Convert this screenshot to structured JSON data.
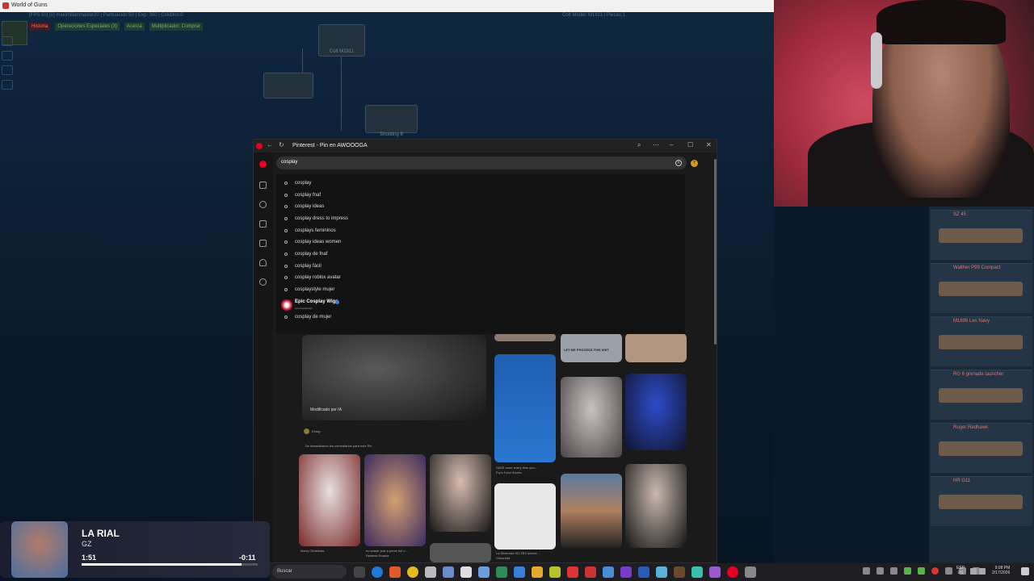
{
  "game": {
    "window_title": "World of Guns",
    "stats_left": "[FPS 50] [#] maximilianmaster20 | Puntuación:50 | Exp: 360 | Créditos:0",
    "stats_right": "Colt Model: M1911 | Piezas:1",
    "tabs": [
      "Historia",
      "Operaciones Especiales (3)",
      "Acerca",
      "Multiplicador: Comprar"
    ],
    "nodes": [
      "Colt M1911",
      "Shooting 6"
    ]
  },
  "gun_panel": {
    "items": [
      "SZ 45",
      "Walther P99 Compact",
      "M1896 Les Navy",
      "RG 6 grenade launcher",
      "Ruger Redhawk",
      "HR G11"
    ]
  },
  "music": {
    "title": "LA RIAL",
    "artist": "GZ",
    "current_time": "1:51",
    "remaining_time": "-0:11",
    "progress": 0.91
  },
  "pinterest": {
    "window_title": "Pinterest - Pin en AWOOOGA",
    "search_value": "cosplay",
    "avatar_letter": "Y",
    "suggestions": [
      "cosplay",
      "cosplay fnaf",
      "cosplay ideas",
      "cosplay dress to impress",
      "cosplays femininos",
      "cosplay ideas women",
      "cosplay de fnaf",
      "cosplay fácil",
      "cosplay roblox avatar",
      "cosplaystyle mujer"
    ],
    "profile_suggestion": {
      "name": "Epic Cosplay Wigs",
      "handle": "epiccosplaywigs"
    },
    "last_suggestion": "cosplay de mujer",
    "pin_overlay": "Modificado por IA",
    "pin_user": "Ehsrg",
    "comments_disabled": "Se desactivaron los comentarios para este Pin",
    "captions": [
      "Merry Christmas",
      "no waste, just a purse full o...",
      "Hostess Snacks",
      "SAVE more every time you...",
      "Fry's Food Stores",
      "La Silverado HD ZR2 necesi...",
      "Chevrolet"
    ],
    "meme_text": "LET ME PROCESS THIS SHIT"
  },
  "taskbar": {
    "search_placeholder": "Buscar",
    "lang_top": "ESP",
    "lang_bottom": "US",
    "time": "9:08 PM",
    "date": "2/17/2026"
  },
  "colors": {
    "pinterest_red": "#e60023",
    "accent": "#d39b20"
  }
}
